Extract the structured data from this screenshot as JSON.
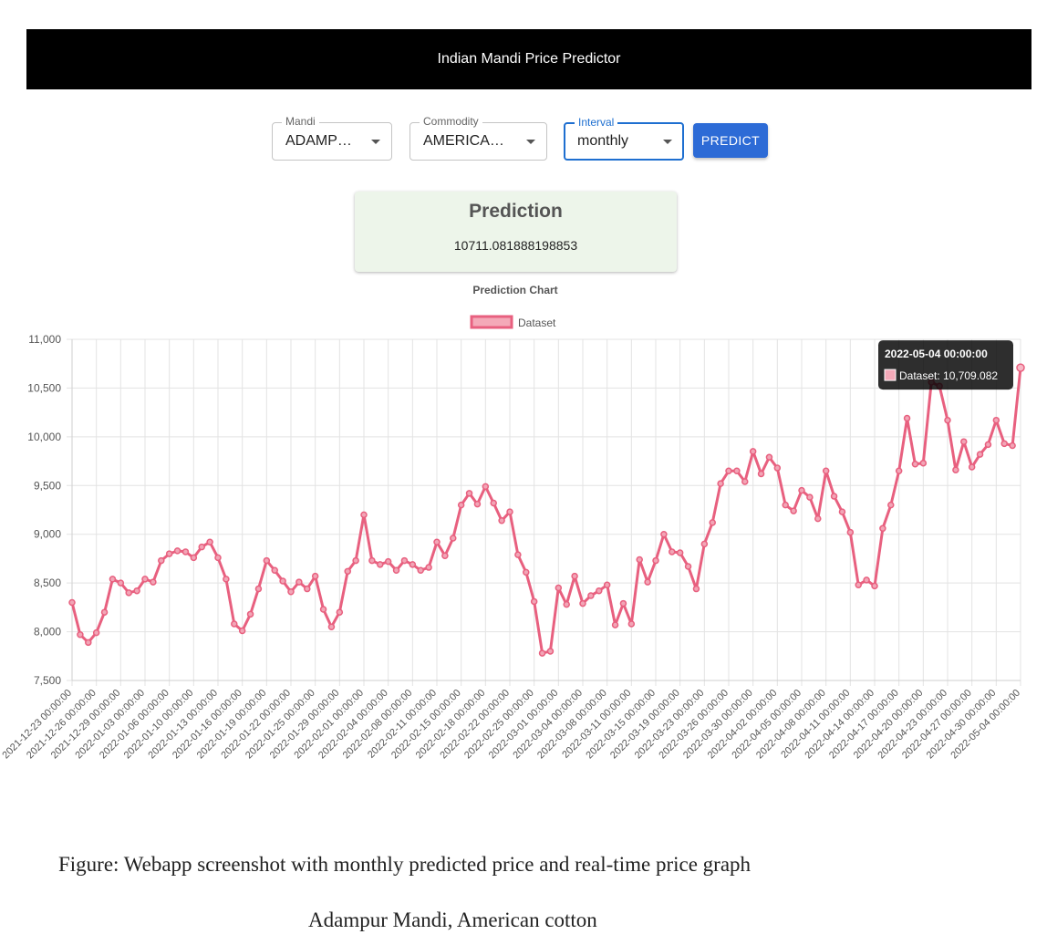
{
  "app": {
    "title": "Indian Mandi Price Predictor"
  },
  "controls": {
    "mandi": {
      "label": "Mandi",
      "value": "ADAMP…"
    },
    "commodity": {
      "label": "Commodity",
      "value": "AMERICA…"
    },
    "interval": {
      "label": "Interval",
      "value": "monthly"
    },
    "predict_label": "PREDICT"
  },
  "prediction": {
    "title": "Prediction",
    "value": "10711.081888198853"
  },
  "colors": {
    "accent": "#2d6bd6",
    "line": "#e8607f",
    "card_bg": "#edf5ea"
  },
  "chart_data": {
    "type": "line",
    "title": "Prediction Chart",
    "legend": {
      "position": "top-center",
      "entries": [
        "Dataset"
      ]
    },
    "grid": true,
    "ylim": [
      7500,
      11000
    ],
    "y_ticks": [
      "7,500",
      "8,000",
      "8,500",
      "9,000",
      "9,500",
      "10,000",
      "10,500",
      "11,000"
    ],
    "x_tick_labels": [
      "2021-12-23 00:00:00",
      "2021-12-26 00:00:00",
      "2021-12-29 00:00:00",
      "2022-01-03 00:00:00",
      "2022-01-06 00:00:00",
      "2022-01-10 00:00:00",
      "2022-01-13 00:00:00",
      "2022-01-16 00:00:00",
      "2022-01-19 00:00:00",
      "2022-01-22 00:00:00",
      "2022-01-25 00:00:00",
      "2022-01-29 00:00:00",
      "2022-02-01 00:00:00",
      "2022-02-04 00:00:00",
      "2022-02-08 00:00:00",
      "2022-02-11 00:00:00",
      "2022-02-15 00:00:00",
      "2022-02-18 00:00:00",
      "2022-02-22 00:00:00",
      "2022-02-25 00:00:00",
      "2022-03-01 00:00:00",
      "2022-03-04 00:00:00",
      "2022-03-08 00:00:00",
      "2022-03-11 00:00:00",
      "2022-03-15 00:00:00",
      "2022-03-19 00:00:00",
      "2022-03-23 00:00:00",
      "2022-03-26 00:00:00",
      "2022-03-30 00:00:00",
      "2022-04-02 00:00:00",
      "2022-04-05 00:00:00",
      "2022-04-08 00:00:00",
      "2022-04-11 00:00:00",
      "2022-04-14 00:00:00",
      "2022-04-17 00:00:00",
      "2022-04-20 00:00:00",
      "2022-04-23 00:00:00",
      "2022-04-27 00:00:00",
      "2022-04-30 00:00:00",
      "2022-05-04 00:00:00"
    ],
    "series": [
      {
        "name": "Dataset",
        "values": [
          8300,
          7970,
          7890,
          7990,
          8200,
          8540,
          8500,
          8400,
          8420,
          8540,
          8510,
          8730,
          8800,
          8830,
          8820,
          8760,
          8870,
          8920,
          8760,
          8540,
          8080,
          8010,
          8180,
          8440,
          8730,
          8630,
          8520,
          8410,
          8510,
          8440,
          8570,
          8230,
          8050,
          8200,
          8620,
          8730,
          9200,
          8730,
          8690,
          8720,
          8630,
          8730,
          8690,
          8630,
          8660,
          8920,
          8780,
          8960,
          9300,
          9420,
          9310,
          9490,
          9320,
          9140,
          9230,
          8790,
          8610,
          8310,
          7780,
          7800,
          8450,
          8280,
          8570,
          8290,
          8370,
          8420,
          8480,
          8070,
          8290,
          8080,
          8740,
          8510,
          8730,
          9000,
          8820,
          8810,
          8670,
          8440,
          8900,
          9120,
          9520,
          9650,
          9650,
          9540,
          9850,
          9620,
          9790,
          9680,
          9300,
          9240,
          9450,
          9380,
          9160,
          9650,
          9390,
          9230,
          9020,
          8480,
          8530,
          8470,
          9060,
          9300,
          9650,
          10190,
          9720,
          9730,
          10560,
          10520,
          10170,
          9660,
          9950,
          9690,
          9820,
          9920,
          10170,
          9930,
          9910,
          10709.082
        ]
      }
    ],
    "tooltip": {
      "title": "2022-05-04 00:00:00",
      "label": "Dataset: 10,709.082"
    }
  },
  "captions": {
    "line1": "Figure: Webapp screenshot with monthly predicted price and  real-time price graph",
    "line2": "Adampur Mandi, American cotton"
  }
}
